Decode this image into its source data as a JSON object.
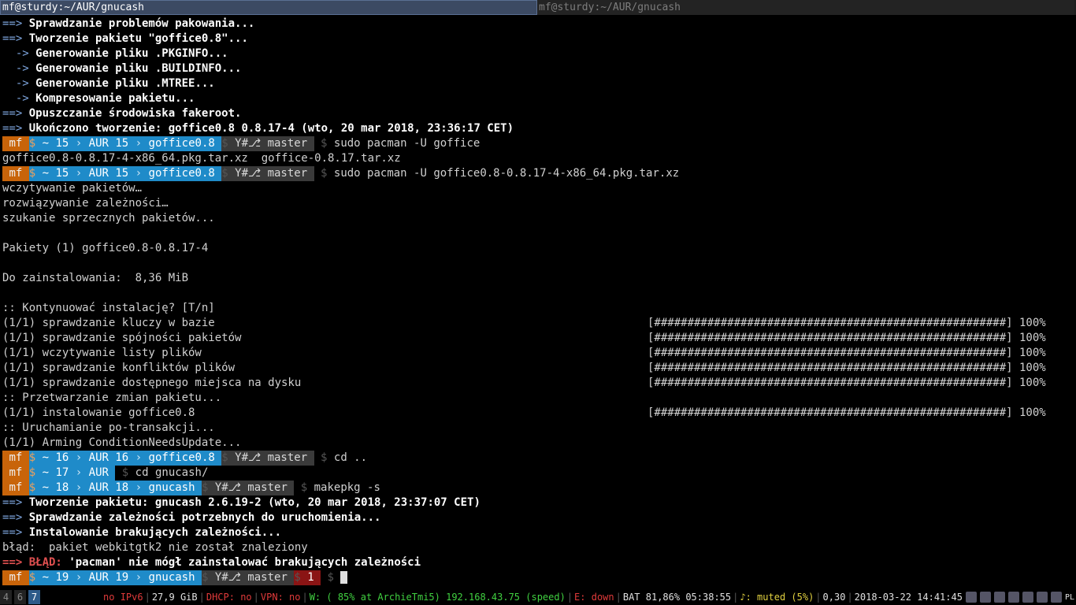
{
  "tabs": [
    {
      "title": "mf@sturdy:~/AUR/gnucash",
      "active": true
    },
    {
      "title": "mf@sturdy:~/AUR/gnucash",
      "active": false
    }
  ],
  "lines": [
    {
      "pre": "==> ",
      "text": "Sprawdzanie problemów pakowania..."
    },
    {
      "pre": "==> ",
      "text": "Tworzenie pakietu \"goffice0.8\"..."
    },
    {
      "pre": "  -> ",
      "text": "Generowanie pliku .PKGINFO..."
    },
    {
      "pre": "  -> ",
      "text": "Generowanie pliku .BUILDINFO..."
    },
    {
      "pre": "  -> ",
      "text": "Generowanie pliku .MTREE..."
    },
    {
      "pre": "  -> ",
      "text": "Kompresowanie pakietu..."
    },
    {
      "pre": "==> ",
      "text": "Opuszczanie środowiska fakeroot."
    },
    {
      "pre": "==> ",
      "text": "Ukończono tworzenie: goffice0.8 0.8.17-4 (wto, 20 mar 2018, 23:36:17 CET)"
    }
  ],
  "prompts": {
    "p1": {
      "user": "mf",
      "home": "~ 15",
      "dir1": "AUR 15",
      "dir2": "goffice0.8",
      "git": "Y#",
      "branch": "master",
      "cmd": "sudo pacman -U goffice"
    },
    "completions": "goffice0.8-0.8.17-4-x86_64.pkg.tar.xz  goffice-0.8.17.tar.xz",
    "p2": {
      "user": "mf",
      "home": "~ 15",
      "dir1": "AUR 15",
      "dir2": "goffice0.8",
      "git": "Y#",
      "branch": "master",
      "cmd": "sudo pacman -U goffice0.8-0.8.17-4-x86_64.pkg.tar.xz"
    },
    "p3": {
      "user": "mf",
      "home": "~ 16",
      "dir1": "AUR 16",
      "dir2": "goffice0.8",
      "git": "Y#",
      "branch": "master",
      "cmd": "cd .."
    },
    "p4": {
      "user": "mf",
      "home": "~ 17",
      "dir1": "AUR",
      "cmd": "cd gnucash/"
    },
    "p5": {
      "user": "mf",
      "home": "~ 18",
      "dir1": "AUR 18",
      "dir2": "gnucash",
      "git": "Y#",
      "branch": "master",
      "cmd": "makepkg -s"
    },
    "p6": {
      "user": "mf",
      "home": "~ 19",
      "dir1": "AUR 19",
      "dir2": "gnucash",
      "git": "Y#",
      "branch": "master",
      "err": "1"
    }
  },
  "pacman": {
    "l1": "wczytywanie pakietów…",
    "l2": "rozwiązywanie zależności…",
    "l3": "szukanie sprzecznych pakietów...",
    "l4": "Pakiety (1) goffice0.8-0.8.17-4",
    "l5": "Do zainstalowania:  8,36 MiB",
    "l6": ":: Kontynuować instalację? [T/n]",
    "p1": "(1/1) sprawdzanie kluczy w bazie",
    "p2": "(1/1) sprawdzanie spójności pakietów",
    "p3": "(1/1) wczytywanie listy plików",
    "p4": "(1/1) sprawdzanie konfliktów plików",
    "p5": "(1/1) sprawdzanie dostępnego miejsca na dysku",
    "l7": ":: Przetwarzanie zmian pakietu...",
    "p6": "(1/1) instalowanie goffice0.8",
    "l8": ":: Uruchamianie po-transakcji...",
    "l9": "(1/1) Arming ConditionNeedsUpdate...",
    "bar": "[#####################################################] 100%"
  },
  "makepkg": {
    "m1": "Tworzenie pakietu: gnucash 2.6.19-2 (wto, 20 mar 2018, 23:37:07 CET)",
    "m2": "Sprawdzanie zależności potrzebnych do uruchomienia...",
    "m3": "Instalowanie brakujących zależności...",
    "m4": "błąd:  pakiet webkitgtk2 nie został znaleziony",
    "m5_label": "BŁĄD:",
    "m5": "'pacman' nie mógł zainstalować brakujących zależności"
  },
  "status": {
    "workspaces": [
      "4",
      "6",
      "7"
    ],
    "active_workspace": "7",
    "ipv6": "no IPv6",
    "disk": "27,9 GiB",
    "dhcp": "DHCP: no",
    "vpn": "VPN: no",
    "wifi": "W: ( 85% at ArchieTmi5) 192.168.43.75 (speed)",
    "eth": "E: down",
    "bat": "BAT 81,86% 05:38:55",
    "vol": "♪: muted (5%)",
    "load": "0,30",
    "datetime": "2018-03-22 14:41:45",
    "kbd": "PL"
  },
  "colors": {
    "prompt_user": "#c8640a",
    "prompt_dir": "#1f8bc9",
    "prompt_git": "#3a3a3a",
    "error": "#e05050"
  }
}
